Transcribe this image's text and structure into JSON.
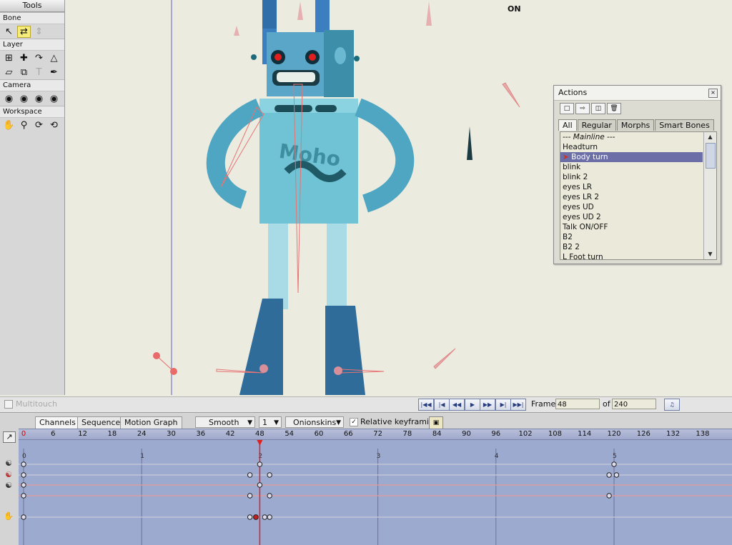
{
  "tools": {
    "title": "Tools",
    "sections": {
      "bone": "Bone",
      "layer": "Layer",
      "camera": "Camera",
      "workspace": "Workspace"
    }
  },
  "canvas": {
    "on_label": "ON"
  },
  "actions": {
    "title": "Actions",
    "close": "×",
    "tabs": [
      "All",
      "Regular",
      "Morphs",
      "Smart Bones"
    ],
    "items": [
      "--- Mainline ---",
      "Headturn",
      "Body turn",
      "blink",
      "blink 2",
      "eyes LR",
      "eyes LR 2",
      "eyes UD",
      "eyes UD 2",
      "Talk ON/OFF",
      "B2",
      "B2 2",
      "L Foot turn"
    ],
    "selected_index": 2
  },
  "transport": {
    "multitouch": "Multitouch",
    "frame_label": "Frame",
    "frame_value": "48",
    "of_label": "of",
    "total_frames": "240"
  },
  "timeline": {
    "tabs": [
      "Channels",
      "Sequencer",
      "Motion Graph"
    ],
    "interp": "Smooth",
    "step": "1",
    "onionskins": "Onionskins",
    "relative_keyframing": "Relative keyframing",
    "ruler_ticks": [
      "0",
      "6",
      "12",
      "18",
      "24",
      "30",
      "36",
      "42",
      "48",
      "54",
      "60",
      "66",
      "72",
      "78",
      "84",
      "90",
      "96",
      "102",
      "108",
      "114",
      "120",
      "126",
      "132",
      "138"
    ],
    "seconds": [
      "0",
      "1",
      "2",
      "3",
      "4",
      "5"
    ],
    "current_frame": 48
  },
  "colors": {
    "selection": "#6c6ea8",
    "timeline_bg": "#9daad0",
    "playhead": "#e02020"
  }
}
